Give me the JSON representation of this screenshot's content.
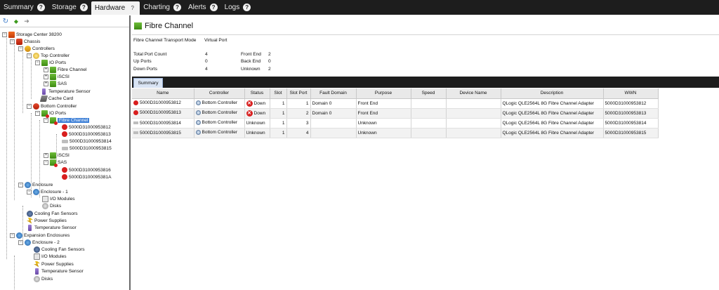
{
  "nav": {
    "tabs": [
      {
        "label": "Summary",
        "help": "?"
      },
      {
        "label": "Storage",
        "help": "?"
      },
      {
        "label": "Hardware",
        "help": "?"
      },
      {
        "label": "Charting",
        "help": "?"
      },
      {
        "label": "Alerts",
        "help": "?"
      },
      {
        "label": "Logs",
        "help": "?"
      }
    ],
    "active_tab": "Hardware"
  },
  "left_toolbar": {
    "icons": [
      "refresh-icon",
      "back-arrow-icon",
      "forward-arrow-icon"
    ],
    "refresh_glyph": "↻",
    "back_glyph": "◆",
    "forward_glyph": "➜"
  },
  "tree": {
    "storage_center": "Storage Center 38200",
    "chassis": "Chassis",
    "controllers": "Controllers",
    "top_controller": "Top Controller",
    "top_io_ports": "IO Ports",
    "top_fibre_channel": "Fibre Channel",
    "top_iscsi": "iSCSI",
    "top_sas": "SAS",
    "top_temperature_sensor": "Temperature Sensor",
    "cache_card": "Cache Card",
    "bottom_controller": "Bottom Controller",
    "bottom_io_ports": "IO Ports",
    "bottom_fibre_channel": "Fibre Channel",
    "fc_ports": [
      "5000D31000953812",
      "5000D31000953813",
      "5000D31000953814",
      "5000D31000953815"
    ],
    "bottom_iscsi": "iSCSI",
    "bottom_sas": "SAS",
    "sas_ports": [
      "5000D31000953816",
      "5000D3100095381A"
    ],
    "enclosure": "Enclosure",
    "enclosure_1": "Enclosure - 1",
    "io_modules_1": "I/O Modules",
    "disks_1": "Disks",
    "cooling_fan_sensors": "Cooling Fan Sensors",
    "power_supplies": "Power Supplies",
    "temperature_sensor": "Temperature Sensor",
    "expansion_enclosures": "Expansion Enclosures",
    "enclosure_2": "Enclosure - 2",
    "enc2_cooling_fan_sensors": "Cooling Fan Sensors",
    "enc2_io_modules": "I/O Modules",
    "enc2_power_supplies": "Power Supplies",
    "enc2_temperature_sensor": "Temperature Sensor",
    "enc2_disks": "Disks",
    "expander": "+",
    "collapser": "−"
  },
  "main": {
    "heading": "Fibre Channel",
    "transport_mode_label": "Fibre Channel Transport Mode",
    "transport_mode_value": "Virtual Port",
    "stats": {
      "total_port_count_label": "Total Port Count",
      "total_port_count_value": "4",
      "up_ports_label": "Up Ports",
      "up_ports_value": "0",
      "down_ports_label": "Down Ports",
      "down_ports_value": "4",
      "front_end_label": "Front End",
      "front_end_value": "2",
      "back_end_label": "Back End",
      "back_end_value": "0",
      "unknown_label": "Unknown",
      "unknown_value": "2"
    },
    "detail_tab": "Summary"
  },
  "table": {
    "columns": [
      "Name",
      "Controller",
      "Status",
      "Slot",
      "Slot Port",
      "Fault Domain",
      "Purpose",
      "Speed",
      "Device Name",
      "Description",
      "WWN"
    ],
    "rows": [
      {
        "name": "5000D31000953812",
        "name_icon": "port-down-icon",
        "controller": "Bottom Controller",
        "status": "Down",
        "status_icon": "status-down-icon",
        "slot": "1",
        "slot_port": "1",
        "fault_domain": "Domain 0",
        "purpose": "Front End",
        "speed": "",
        "device_name": "",
        "description": "QLogic QLE2564L 8G Fibre Channel Adapter",
        "wwn": "5000D31000953812"
      },
      {
        "name": "5000D31000953813",
        "name_icon": "port-down-icon",
        "controller": "Bottom Controller",
        "status": "Down",
        "status_icon": "status-down-icon",
        "slot": "1",
        "slot_port": "2",
        "fault_domain": "Domain 0",
        "purpose": "Front End",
        "speed": "",
        "device_name": "",
        "description": "QLogic QLE2564L 8G Fibre Channel Adapter",
        "wwn": "5000D31000953813"
      },
      {
        "name": "5000D31000953814",
        "name_icon": "port-icon",
        "controller": "Bottom Controller",
        "status": "Unknown",
        "status_icon": "",
        "slot": "1",
        "slot_port": "3",
        "fault_domain": "",
        "purpose": "Unknown",
        "speed": "",
        "device_name": "",
        "description": "QLogic QLE2564L 8G Fibre Channel Adapter",
        "wwn": "5000D31000953814"
      },
      {
        "name": "5000D31000953815",
        "name_icon": "port-icon",
        "controller": "Bottom Controller",
        "status": "Unknown",
        "status_icon": "",
        "slot": "1",
        "slot_port": "4",
        "fault_domain": "",
        "purpose": "Unknown",
        "speed": "",
        "device_name": "",
        "description": "QLogic QLE2564L 8G Fibre Channel Adapter",
        "wwn": "5000D31000953815"
      }
    ],
    "status_down_glyph": "✕"
  },
  "colors": {
    "nav_bg": "#1d1d1d",
    "selection": "#3d7fd6",
    "status_down": "#d82020",
    "ok_green": "#3d8a12"
  }
}
